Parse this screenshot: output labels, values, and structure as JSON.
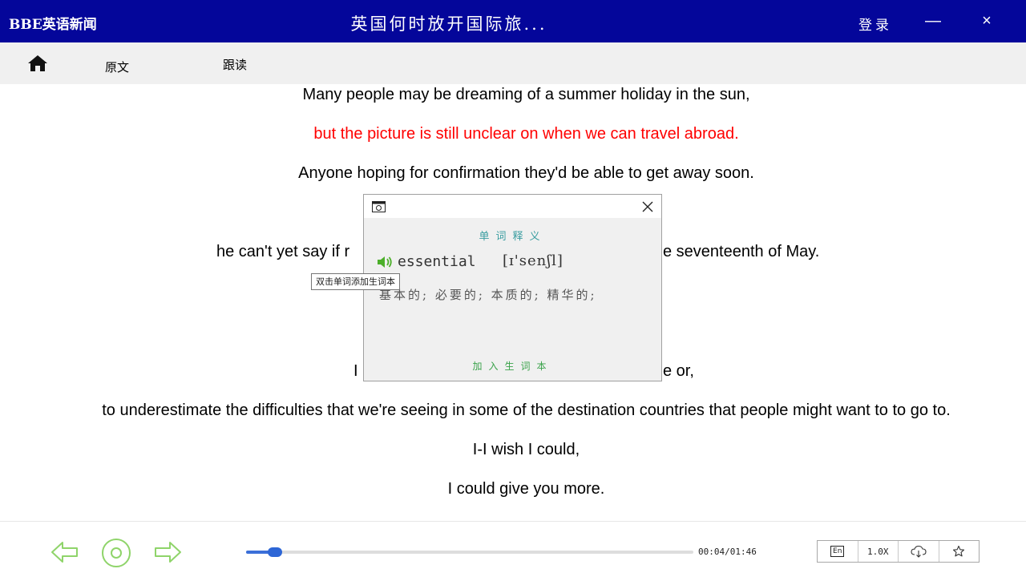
{
  "titlebar": {
    "app_name": "BBE英语新闻",
    "title": "英国何时放开国际旅...",
    "login_label": "登录",
    "minimize_glyph": "—",
    "close_glyph": "×",
    "background": "#04069a"
  },
  "tabs": {
    "home_icon": "home-icon",
    "original_label": "原文",
    "follow_read_label": "跟读"
  },
  "transcript": {
    "active_color": "#ff0000",
    "lines": [
      "Many people may be dreaming of a summer holiday in the sun,",
      "but the picture is still unclear on when we can travel abroad.",
      "Anyone hoping for confirmation they'd be able to get away soon.",
      "he can't yet say if r",
      "e seventeenth of May.",
      "I",
      "e or,",
      "to underestimate the difficulties that we're seeing in some of the destination countries that people might want to to go to.",
      "I-I wish I could,",
      "I could give you more."
    ]
  },
  "popup": {
    "heading": "单词释义",
    "word": "essential",
    "phonetic": "[ɪ'senʃl]",
    "definition": "基本的; 必要的; 本质的; 精华的;",
    "add_label": "加入生词本",
    "heading_color": "#3a9da0",
    "add_color": "#3aa24a"
  },
  "tooltip": {
    "text": "双击单词添加生词本"
  },
  "player": {
    "timecode": "00:04/01:46",
    "progress": 0.065,
    "en_label": "En",
    "speed_label": "1.0X",
    "icons": [
      "arrow-left-icon",
      "play-circle-icon",
      "arrow-right-icon",
      "cloud-download-icon",
      "star-icon"
    ]
  }
}
